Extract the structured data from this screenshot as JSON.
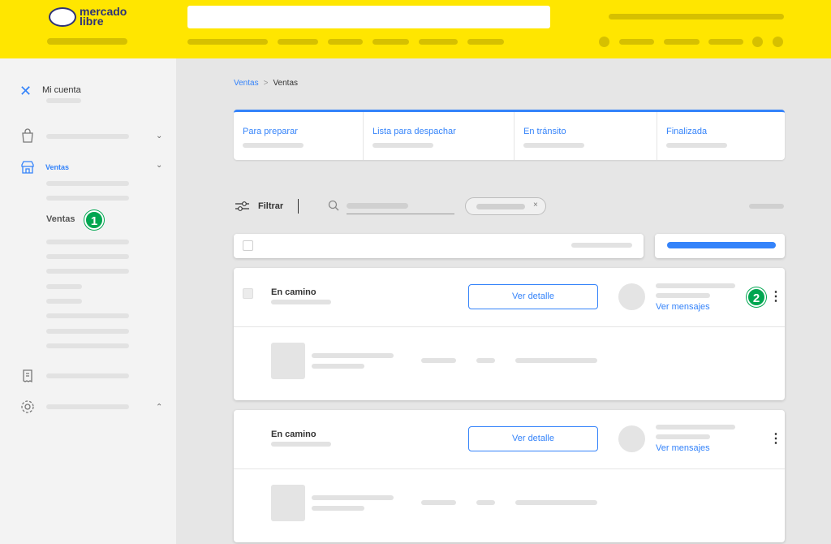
{
  "header": {
    "logo_text_line1": "mercado",
    "logo_text_line2": "libre"
  },
  "sidebar": {
    "close_icon": "close-icon",
    "title": "Mi cuenta",
    "ventas_label": "Ventas",
    "ventas_sub_label": "Ventas",
    "step1": "1"
  },
  "breadcrumb": {
    "link": "Ventas",
    "separator": ">",
    "current": "Ventas"
  },
  "tabs": [
    {
      "label": "Para preparar"
    },
    {
      "label": "Lista para despachar"
    },
    {
      "label": "En tránsito"
    },
    {
      "label": "Finalizada"
    }
  ],
  "toolbar": {
    "filter_label": "Filtrar",
    "chip_close": "×"
  },
  "orders": [
    {
      "status": "En camino",
      "detail_button": "Ver detalle",
      "messages_link": "Ver mensajes",
      "step": "2",
      "menu": "⋮"
    },
    {
      "status": "En camino",
      "detail_button": "Ver detalle",
      "messages_link": "Ver mensajes",
      "menu": "⋮"
    }
  ],
  "colors": {
    "brand_yellow": "#ffe600",
    "accent_blue": "#3483fa",
    "step_green": "#00a650"
  }
}
